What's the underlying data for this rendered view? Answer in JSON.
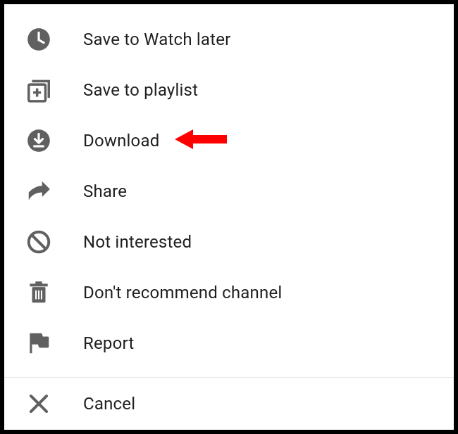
{
  "menu": {
    "items": [
      {
        "id": "watch-later",
        "label": "Save to Watch later"
      },
      {
        "id": "save-playlist",
        "label": "Save to playlist"
      },
      {
        "id": "download",
        "label": "Download",
        "highlighted": true
      },
      {
        "id": "share",
        "label": "Share"
      },
      {
        "id": "not-interested",
        "label": "Not interested"
      },
      {
        "id": "dont-recommend",
        "label": "Don't recommend channel"
      },
      {
        "id": "report",
        "label": "Report"
      }
    ],
    "cancel_label": "Cancel"
  },
  "colors": {
    "icon_gray": "#606060",
    "text": "#202020",
    "arrow": "#ff0000"
  }
}
